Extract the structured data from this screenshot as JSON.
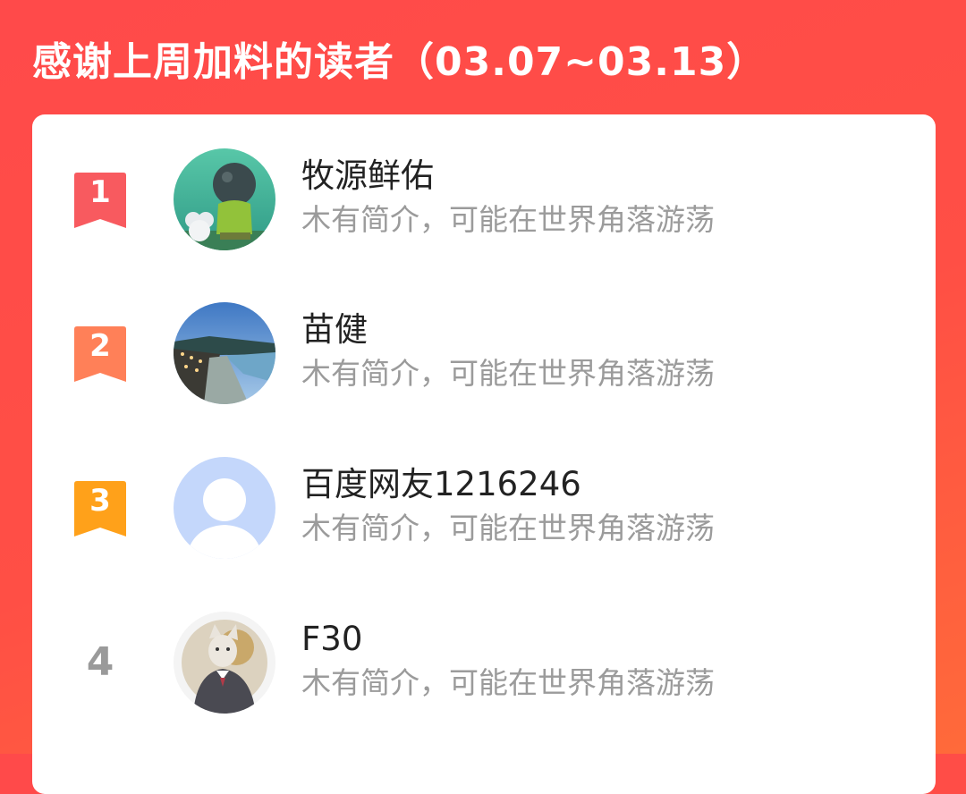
{
  "header": {
    "title": "感谢上周加料的读者（03.07~03.13）"
  },
  "colors": {
    "rank_1": "#f85a5f",
    "rank_2": "#ff8058",
    "rank_3": "#ffa11a",
    "rank_other": "#9a9a9a",
    "header_bg": "#ff4a4a"
  },
  "readers": [
    {
      "rank": "1",
      "name": "牧源鲜佑",
      "bio": "木有简介，可能在世界角落游荡",
      "avatar": "boy-illustration-avatar"
    },
    {
      "rank": "2",
      "name": "苗健",
      "bio": "木有简介，可能在世界角落游荡",
      "avatar": "riverside-photo-avatar"
    },
    {
      "rank": "3",
      "name": "百度网友1216246",
      "bio": "木有简介，可能在世界角落游荡",
      "avatar": "default-user-avatar"
    },
    {
      "rank": "4",
      "name": "F30",
      "bio": "木有简介，可能在世界角落游荡",
      "avatar": "cat-in-suit-avatar"
    }
  ]
}
